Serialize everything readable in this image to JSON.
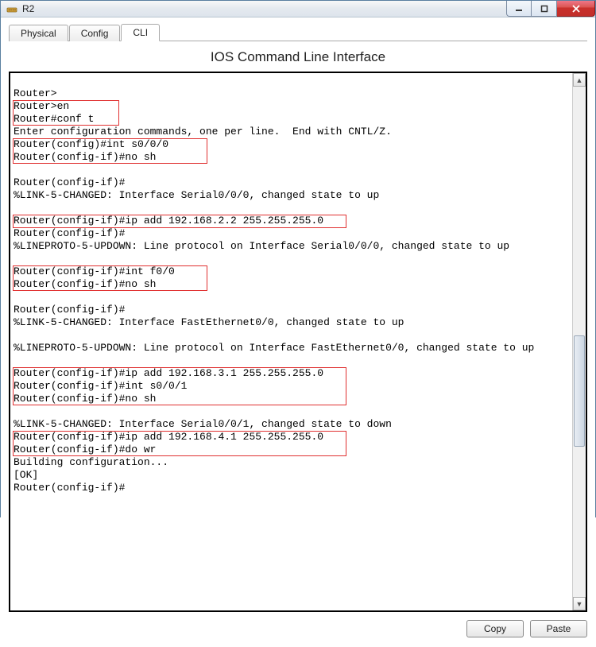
{
  "window": {
    "title": "R2"
  },
  "tabs": {
    "physical": "Physical",
    "config": "Config",
    "cli": "CLI"
  },
  "panel": {
    "title": "IOS Command Line Interface"
  },
  "terminal": {
    "lines": [
      "",
      "Router>",
      "Router>en",
      "Router#conf t",
      "Enter configuration commands, one per line.  End with CNTL/Z.",
      "Router(config)#int s0/0/0",
      "Router(config-if)#no sh",
      "",
      "Router(config-if)#",
      "%LINK-5-CHANGED: Interface Serial0/0/0, changed state to up",
      "",
      "Router(config-if)#ip add 192.168.2.2 255.255.255.0",
      "Router(config-if)#",
      "%LINEPROTO-5-UPDOWN: Line protocol on Interface Serial0/0/0, changed state to up",
      "",
      "Router(config-if)#int f0/0",
      "Router(config-if)#no sh",
      "",
      "Router(config-if)#",
      "%LINK-5-CHANGED: Interface FastEthernet0/0, changed state to up",
      "",
      "%LINEPROTO-5-UPDOWN: Line protocol on Interface FastEthernet0/0, changed state to up",
      "",
      "Router(config-if)#ip add 192.168.3.1 255.255.255.0",
      "Router(config-if)#int s0/0/1",
      "Router(config-if)#no sh",
      "",
      "%LINK-5-CHANGED: Interface Serial0/0/1, changed state to down",
      "Router(config-if)#ip add 192.168.4.1 255.255.255.0",
      "Router(config-if)#do wr",
      "Building configuration...",
      "[OK]",
      "Router(config-if)#"
    ]
  },
  "buttons": {
    "copy": "Copy",
    "paste": "Paste"
  }
}
